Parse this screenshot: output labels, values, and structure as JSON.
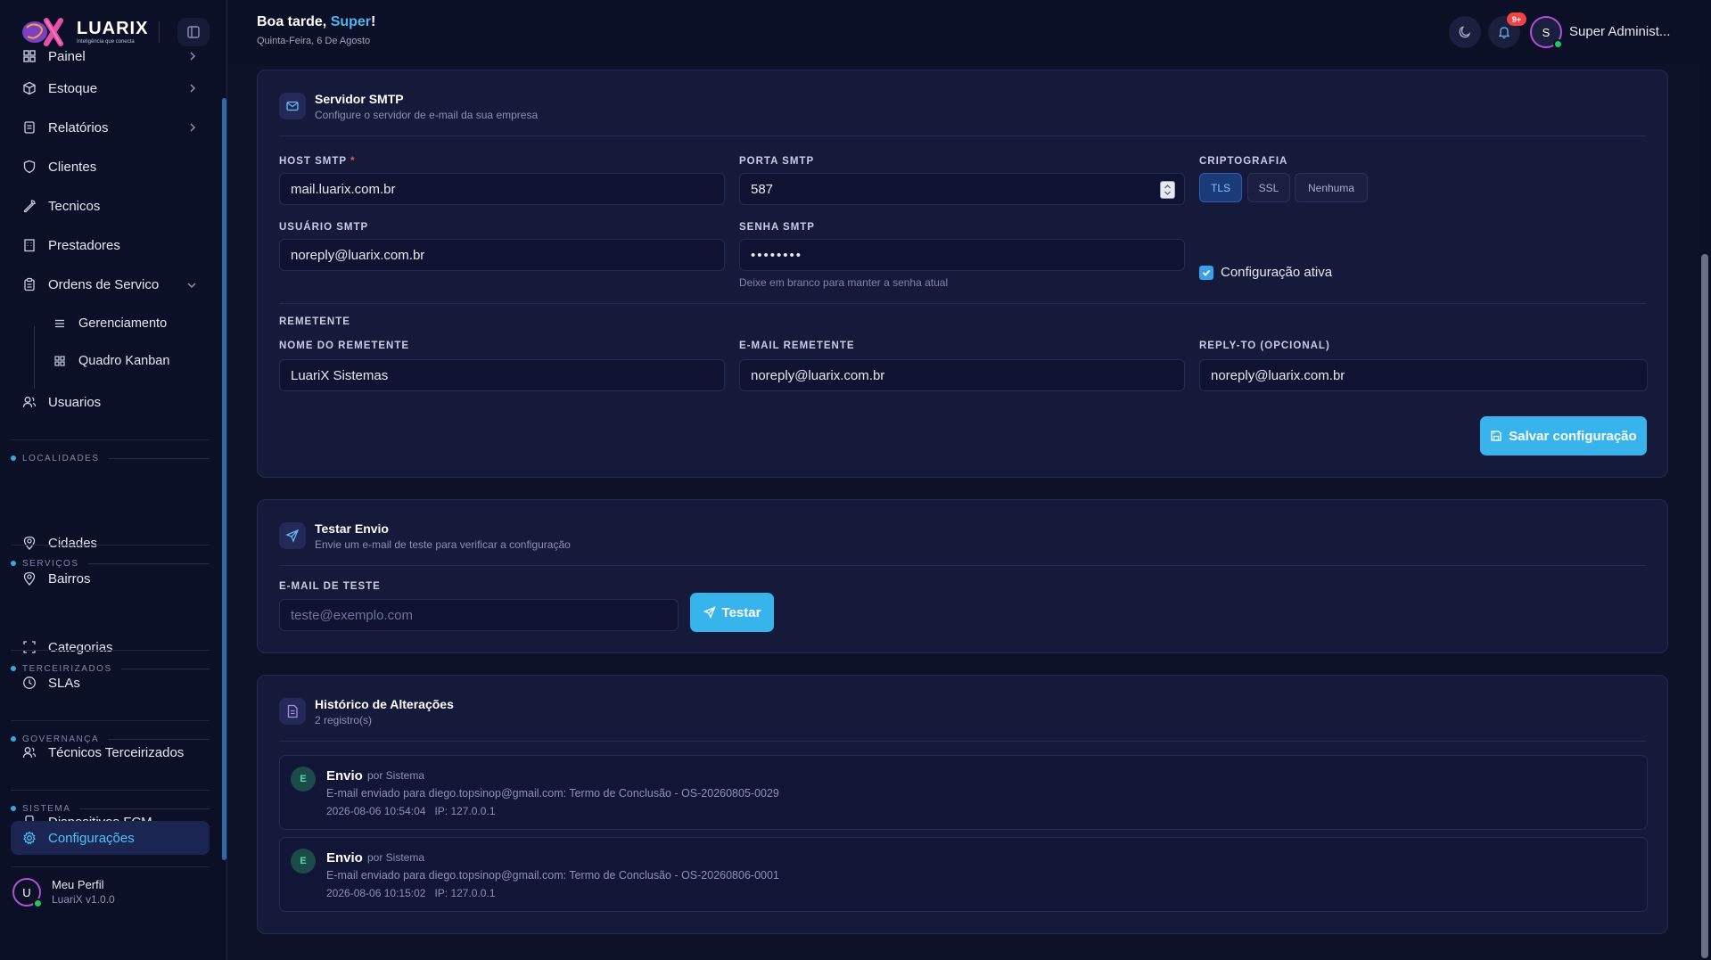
{
  "brand": {
    "name": "LUARIX",
    "tagline": "Inteligência que conecta"
  },
  "header": {
    "greeting_prefix": "Boa tarde, ",
    "greeting_name": "Super",
    "greeting_suffix": "!",
    "date": "Quinta-Feira, 6 De Agosto",
    "notifications_badge": "9+",
    "user_initial": "S",
    "user_name": "Super Administ..."
  },
  "sidebar": {
    "items": {
      "painel": "Painel",
      "estoque": "Estoque",
      "relatorios": "Relatórios",
      "clientes": "Clientes",
      "tecnicos": "Tecnicos",
      "prestadores": "Prestadores",
      "ordens": "Ordens de Servico",
      "gerenciamento": "Gerenciamento",
      "kanban": "Quadro Kanban",
      "usuarios": "Usuarios",
      "cidades": "Cidades",
      "bairros": "Bairros",
      "categorias": "Categorias",
      "slas": "SLAs",
      "tecnicos_terc": "Técnicos Terceirizados",
      "dispositivos": "Dispositivos FCM",
      "configuracoes": "Configurações"
    },
    "sections": {
      "localidades": "LOCALIDADES",
      "servicos": "SERVIÇOS",
      "terceirizados": "TERCEIRIZADOS",
      "governanca": "GOVERNANÇA",
      "sistema": "SISTEMA"
    },
    "profile": {
      "initial": "U",
      "name": "Meu Perfil",
      "version": "LuariX v1.0.0"
    }
  },
  "smtp": {
    "title": "Servidor SMTP",
    "subtitle": "Configure o servidor de e-mail da sua empresa",
    "host_label": "HOST SMTP",
    "host_required": "*",
    "host_value": "mail.luarix.com.br",
    "port_label": "PORTA SMTP",
    "port_value": "587",
    "crypto_label": "CRIPTOGRAFIA",
    "crypto_options": [
      "TLS",
      "SSL",
      "Nenhuma"
    ],
    "crypto_selected": "TLS",
    "user_label": "USUÁRIO SMTP",
    "user_value": "noreply@luarix.com.br",
    "password_label": "SENHA SMTP",
    "password_value": "••••••••",
    "password_hint": "Deixe em branco para manter a senha atual",
    "active_label": "Configuração ativa",
    "active_checked": true,
    "sender_section": "REMETENTE",
    "sender_name_label": "NOME DO REMETENTE",
    "sender_name_value": "LuariX Sistemas",
    "sender_email_label": "E-MAIL REMETENTE",
    "sender_email_value": "noreply@luarix.com.br",
    "reply_to_label": "REPLY-TO (OPCIONAL)",
    "reply_to_value": "noreply@luarix.com.br",
    "save_label": "Salvar configuração"
  },
  "test": {
    "title": "Testar Envio",
    "subtitle": "Envie um e-mail de teste para verificar a configuração",
    "email_label": "E-MAIL DE TESTE",
    "email_placeholder": "teste@exemplo.com",
    "button_label": "Testar"
  },
  "history": {
    "title": "Histórico de Alterações",
    "count": "2 registro(s)",
    "entries": [
      {
        "initial": "E",
        "type": "Envio",
        "by": "por Sistema",
        "description": "E-mail enviado para diego.topsinop@gmail.com: Termo de Conclusão - OS-20260805-0029",
        "timestamp": "2026-08-06 10:54:04",
        "ip": "IP: 127.0.0.1"
      },
      {
        "initial": "E",
        "type": "Envio",
        "by": "por Sistema",
        "description": "E-mail enviado para diego.topsinop@gmail.com: Termo de Conclusão - OS-20260806-0001",
        "timestamp": "2026-08-06 10:15:02",
        "ip": "IP: 127.0.0.1"
      }
    ]
  },
  "colors": {
    "accent": "#38b4ec",
    "background": "#0e1229",
    "card": "#15193a",
    "active_nav": "#1b2552"
  }
}
